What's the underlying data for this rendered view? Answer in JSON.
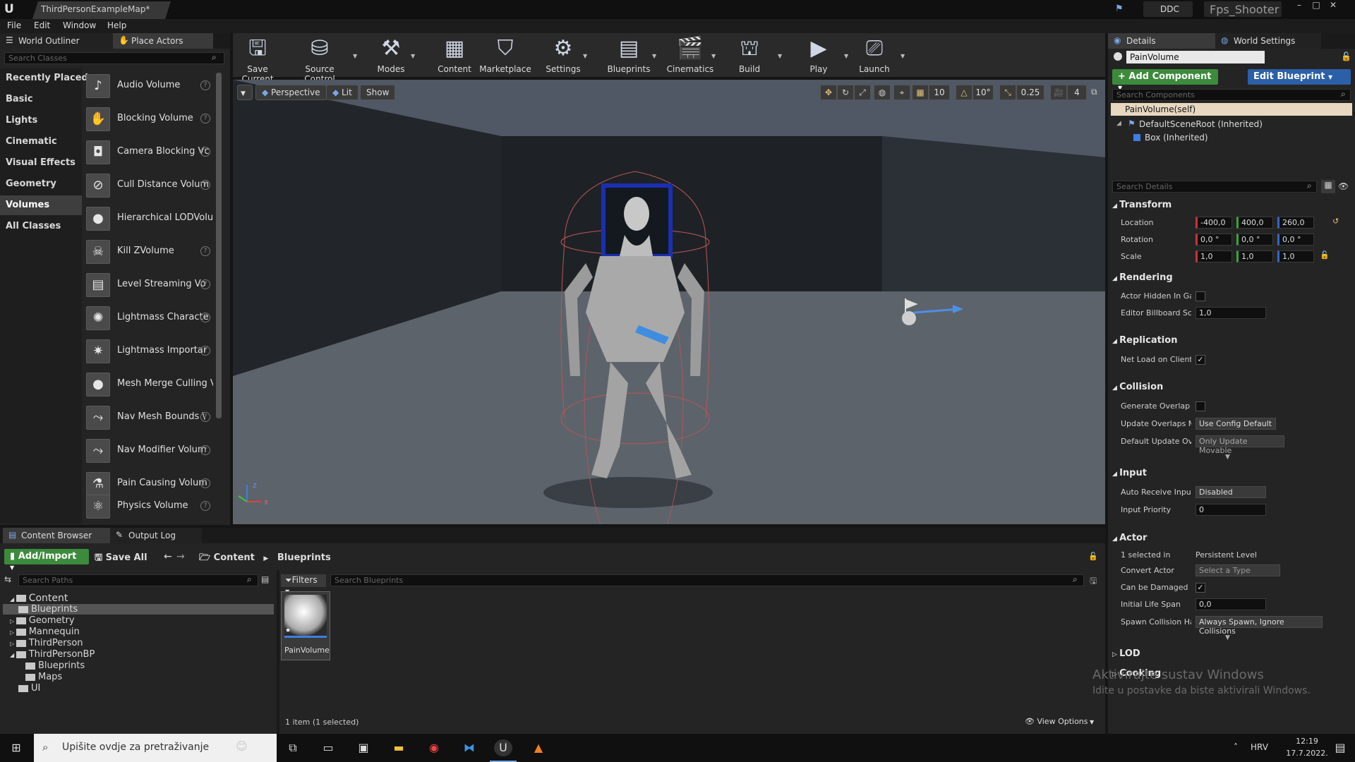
{
  "titlebar": {
    "doc_tab": "ThirdPersonExampleMap*",
    "ddc": "DDC",
    "project": "Fps_Shooter",
    "logo": "U"
  },
  "menu": [
    "File",
    "Edit",
    "Window",
    "Help"
  ],
  "left_tabs": {
    "outliner": "World Outliner",
    "place": "Place Actors"
  },
  "place": {
    "search_placeholder": "Search Classes",
    "categories": [
      "Recently Placed",
      "Basic",
      "Lights",
      "Cinematic",
      "Visual Effects",
      "Geometry",
      "Volumes",
      "All Classes"
    ],
    "selected_category": "Volumes",
    "actors": [
      "Audio Volume",
      "Blocking Volume",
      "Camera Blocking Vc",
      "Cull Distance Volum",
      "Hierarchical LODVolum",
      "Kill ZVolume",
      "Level Streaming Vo",
      "Lightmass Characte",
      "Lightmass Importar",
      "Mesh Merge Culling Vo",
      "Nav Mesh Bounds \\",
      "Nav Modifier Volum",
      "Pain Causing Volum",
      "Physics Volume"
    ]
  },
  "toolbar": [
    "Save Current",
    "Source Control",
    "Modes",
    "Content",
    "Marketplace",
    "Settings",
    "Blueprints",
    "Cinematics",
    "Build",
    "Play",
    "Launch"
  ],
  "viewport": {
    "perspective": "Perspective",
    "lit": "Lit",
    "show": "Show",
    "grid": "10",
    "angle": "10°",
    "scale": "0.25",
    "speed": "4",
    "axis_z": "z",
    "axis_x": "x"
  },
  "details": {
    "tabs": {
      "details": "Details",
      "world": "World Settings"
    },
    "name": "PainVolume",
    "add_component": "+ Add Component",
    "edit_blueprint": "Edit Blueprint",
    "search_components": "Search Components",
    "components": [
      "PainVolume(self)",
      "DefaultSceneRoot (Inherited)",
      "Box (Inherited)"
    ],
    "search_details": "Search Details",
    "transform": {
      "title": "Transform",
      "location_label": "Location",
      "rotation_label": "Rotation",
      "scale_label": "Scale",
      "location": [
        "-400,0",
        "400,0",
        "260,0"
      ],
      "rotation": [
        "0,0 °",
        "0,0 °",
        "0,0 °"
      ],
      "scale": [
        "1,0",
        "1,0",
        "1,0"
      ]
    },
    "rendering": {
      "title": "Rendering",
      "hidden": "Actor Hidden In Gan",
      "billboard": "Editor Billboard Sca",
      "billboard_val": "1,0"
    },
    "replication": {
      "title": "Replication",
      "net_load": "Net Load on Client"
    },
    "collision": {
      "title": "Collision",
      "gen_overlap": "Generate Overlap E\\",
      "update_overlaps": "Update Overlaps Me",
      "update_val": "Use Config Default",
      "default_update": "Default Update Ove",
      "default_val": "Only Update Movable"
    },
    "input": {
      "title": "Input",
      "auto_receive": "Auto Receive Input",
      "auto_val": "Disabled",
      "priority": "Input Priority",
      "priority_val": "0"
    },
    "actor": {
      "title": "Actor",
      "selected_in": "1 selected in",
      "level": "Persistent Level",
      "convert": "Convert Actor",
      "convert_val": "Select a Type",
      "damaged": "Can be Damaged",
      "life": "Initial Life Span",
      "life_val": "0,0",
      "spawn": "Spawn Collision Har",
      "spawn_val": "Always Spawn, Ignore Collisions"
    },
    "lod": "LOD",
    "cooking": "Cooking"
  },
  "content_browser": {
    "tabs": {
      "cb": "Content Browser",
      "log": "Output Log"
    },
    "add_import": "Add/Import",
    "save_all": "Save All",
    "path": [
      "Content",
      "Blueprints"
    ],
    "search_paths": "Search Paths",
    "filters": "Filters",
    "search_blueprints": "Search Blueprints",
    "tree": [
      "Content",
      "Blueprints",
      "Geometry",
      "Mannequin",
      "ThirdPerson",
      "ThirdPersonBP",
      "Blueprints",
      "Maps",
      "UI"
    ],
    "asset": "PainVolume",
    "status": "1 item (1 selected)",
    "view_options": "View Options"
  },
  "watermark": {
    "line1": "Aktivirajte sustav Windows",
    "line2": "Idite u postavke da biste aktivirali Windows."
  },
  "taskbar": {
    "search": "Upišite ovdje za pretraživanje",
    "lang": "HRV",
    "time": "12:19",
    "date": "17.7.2022."
  }
}
